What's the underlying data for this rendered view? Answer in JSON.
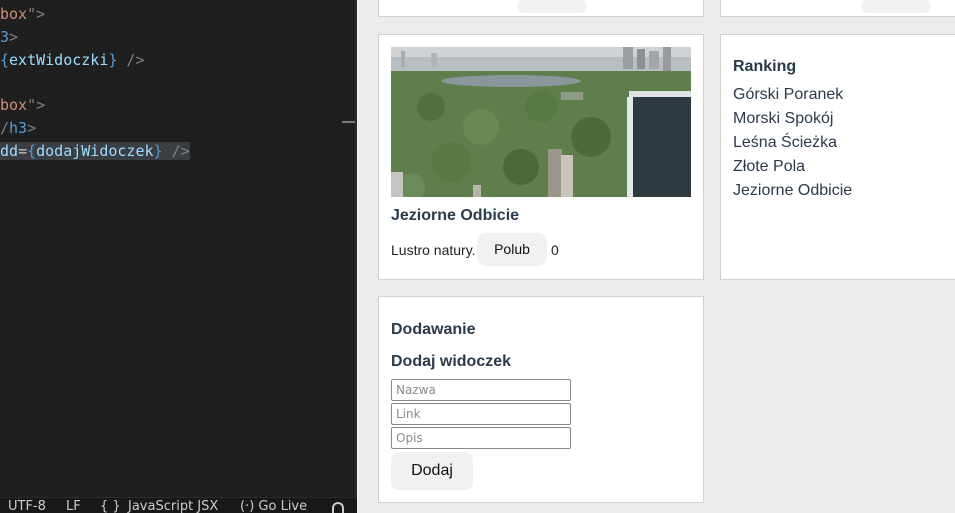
{
  "editor": {
    "lines": [
      {
        "parts": [
          [
            "box",
            "str"
          ],
          [
            "\">",
            "tag"
          ]
        ]
      },
      {
        "parts": [
          [
            "3",
            "tagname"
          ],
          [
            ">",
            "tag"
          ]
        ]
      },
      {
        "parts": [
          [
            "{",
            "brace"
          ],
          [
            "extWidoczki",
            "var"
          ],
          [
            "}",
            "brace"
          ],
          [
            " />",
            "tag"
          ]
        ]
      },
      {
        "parts": []
      },
      {
        "parts": [
          [
            "box",
            "str"
          ],
          [
            "\">",
            "tag"
          ]
        ]
      },
      {
        "parts": [
          [
            "/",
            "tag"
          ],
          [
            "h3",
            "tagname"
          ],
          [
            ">",
            "tag"
          ]
        ]
      },
      {
        "parts": [
          [
            "dd",
            "attr"
          ],
          [
            "=",
            "plain"
          ],
          [
            "{",
            "brace"
          ],
          [
            "dodajWidoczek",
            "var"
          ],
          [
            "}",
            "brace"
          ],
          [
            " />",
            "tag"
          ]
        ],
        "selected": true
      }
    ]
  },
  "statusbar": {
    "encoding": "UTF-8",
    "eol": "LF",
    "braces": "{ }",
    "language": "JavaScript JSX",
    "golive": "Go Live"
  },
  "app": {
    "photo_card": {
      "title": "Jeziorne Odbicie",
      "description": "Lustro natury.",
      "like_label": "Polub",
      "likes": "0"
    },
    "ranking": {
      "title": "Ranking",
      "items": [
        "Górski Poranek",
        "Morski Spokój",
        "Leśna Ścieżka",
        "Złote Pola",
        "Jeziorne Odbicie"
      ]
    },
    "add_card": {
      "section_title": "Dodawanie",
      "form_title": "Dodaj widoczek",
      "name_placeholder": "Nazwa",
      "link_placeholder": "Link",
      "desc_placeholder": "Opis",
      "submit_label": "Dodaj"
    }
  }
}
